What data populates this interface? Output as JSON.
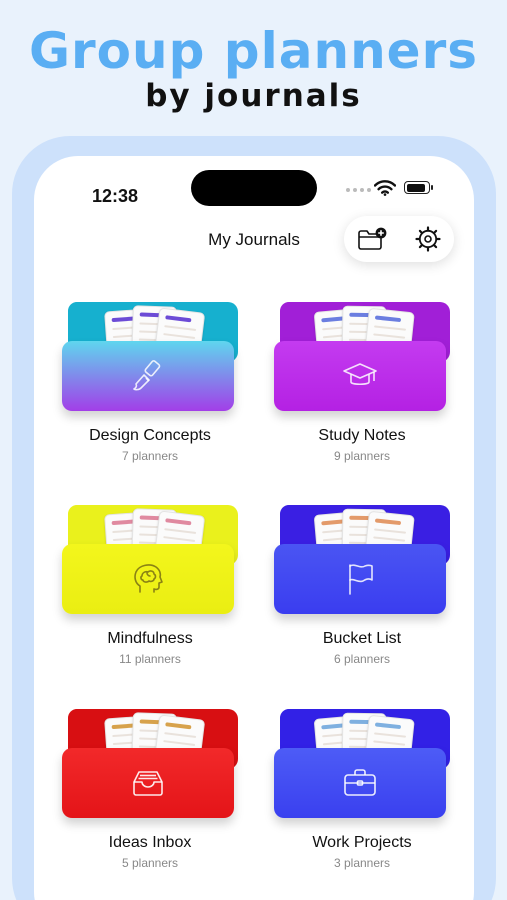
{
  "hero": {
    "title": "Group planners",
    "subtitle": "by journals"
  },
  "status_bar": {
    "time": "12:38"
  },
  "nav": {
    "title": "My Journals",
    "add_folder_icon": "folder-plus-icon",
    "settings_icon": "gear-icon"
  },
  "journals": [
    {
      "name": "Design Concepts",
      "count": "7 planners",
      "icon": "paintbrush-icon",
      "colors": {
        "back": "#16b0cf",
        "front_top": "#5fd6ee",
        "front_bottom": "#a23ee8",
        "accent": "#6c4bd6"
      }
    },
    {
      "name": "Study Notes",
      "count": "9 planners",
      "icon": "graduation-cap-icon",
      "colors": {
        "back": "#a11fd7",
        "front_top": "#c43bf0",
        "front_bottom": "#b421e3",
        "accent": "#6b7ee0"
      }
    },
    {
      "name": "Mindfulness",
      "count": "11 planners",
      "icon": "head-brain-icon",
      "colors": {
        "back": "#eaf11c",
        "front_top": "#f3f61c",
        "front_bottom": "#eaee12",
        "accent": "#e08aa0"
      }
    },
    {
      "name": "Bucket List",
      "count": "6 planners",
      "icon": "flag-icon",
      "colors": {
        "back": "#3a1fe3",
        "front_top": "#4a55f3",
        "front_bottom": "#3a3df0",
        "accent": "#e39a6a"
      }
    },
    {
      "name": "Ideas Inbox",
      "count": "5 planners",
      "icon": "inbox-tray-icon",
      "colors": {
        "back": "#d80f12",
        "front_top": "#f2292a",
        "front_bottom": "#e41418",
        "accent": "#d7a24c"
      }
    },
    {
      "name": "Work Projects",
      "count": "3 planners",
      "icon": "briefcase-icon",
      "colors": {
        "back": "#3221e6",
        "front_top": "#4d5cf6",
        "front_bottom": "#3a40ef",
        "accent": "#7fb0e0"
      }
    }
  ]
}
